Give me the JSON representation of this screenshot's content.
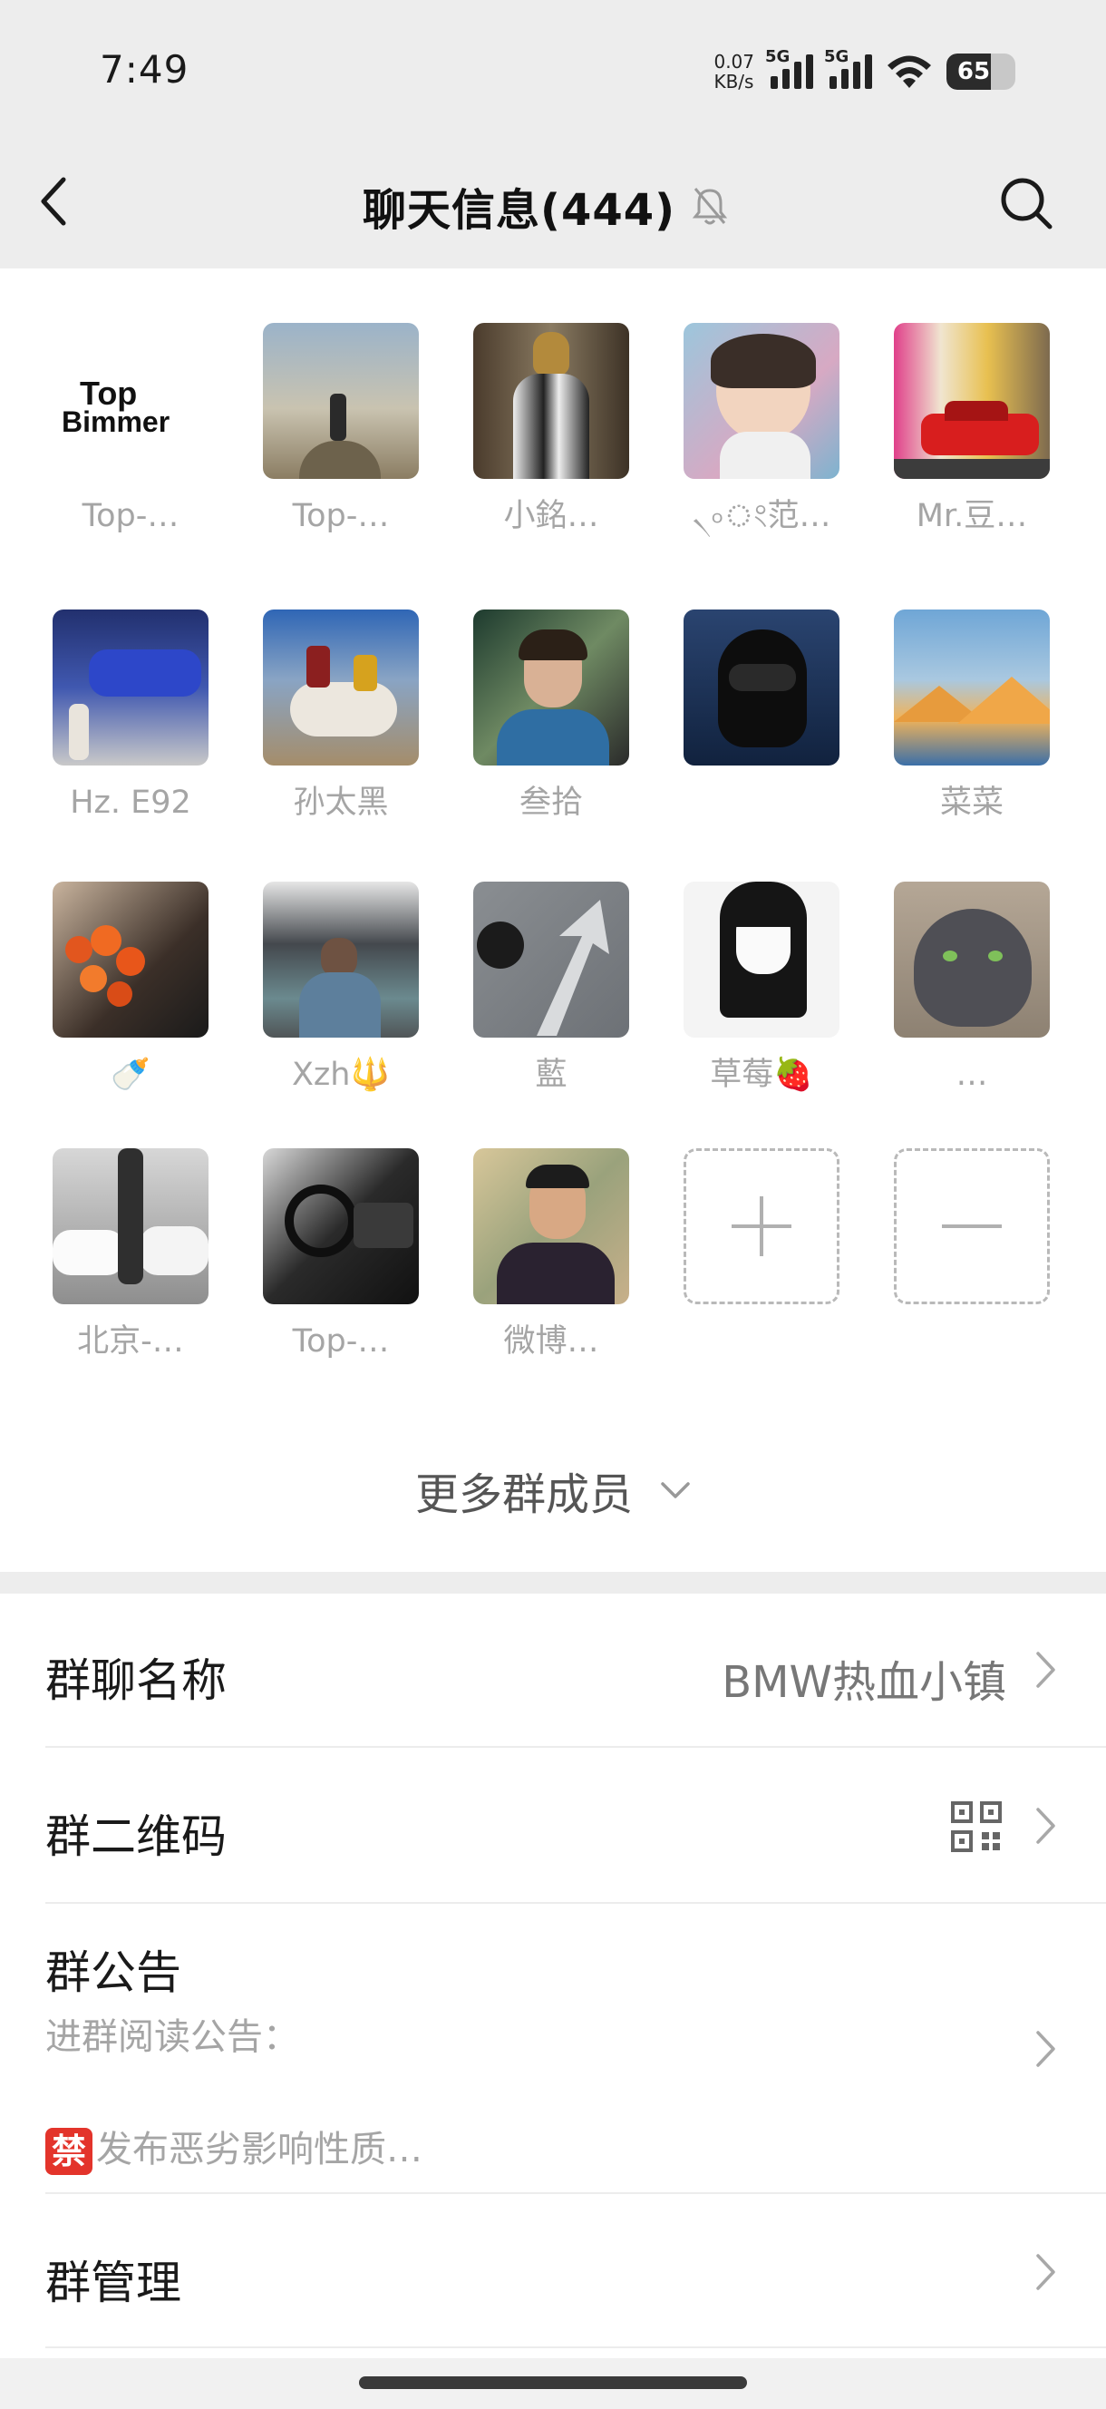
{
  "status_bar": {
    "time": "7:49",
    "net_speed_value": "0.07",
    "net_speed_unit": "KB/s",
    "signal1_label": "5G",
    "signal2_label": "5G",
    "battery_level": 65,
    "battery_text": "65"
  },
  "header": {
    "title": "聊天信息(444)",
    "muted": true
  },
  "members": [
    {
      "name": "Top-…",
      "avatar": "logo-top-bimmer"
    },
    {
      "name": "Top-…",
      "avatar": "photo-desert-person"
    },
    {
      "name": "小銘…",
      "avatar": "photo-iron-man"
    },
    {
      "name": "৲৹ং范…",
      "avatar": "photo-child"
    },
    {
      "name": "Mr.豆…",
      "avatar": "photo-red-car"
    },
    {
      "name": "Hz. E92",
      "avatar": "photo-blue-bmw"
    },
    {
      "name": "孙太黑",
      "avatar": "photo-yak-riders"
    },
    {
      "name": "叁拾",
      "avatar": "photo-young-man"
    },
    {
      "name": "",
      "avatar": "photo-black-helmet"
    },
    {
      "name": "菜菜",
      "avatar": "photo-mountains"
    },
    {
      "name": "🍼",
      "avatar": "photo-orange-flowers"
    },
    {
      "name": "Xzh🔱",
      "avatar": "photo-lake-man"
    },
    {
      "name": "藍",
      "avatar": "photo-arrow-road"
    },
    {
      "name": "草莓🍓",
      "avatar": "drawing-anime-girl"
    },
    {
      "name": "…",
      "avatar": "photo-gray-cat"
    },
    {
      "name": "北京-…",
      "avatar": "photo-white-cars"
    },
    {
      "name": "Top-…",
      "avatar": "photo-car-interior"
    },
    {
      "name": "微博…",
      "avatar": "photo-man-portrait"
    }
  ],
  "more_members_label": "更多群成员",
  "settings": {
    "group_name_label": "群聊名称",
    "group_name_value": "BMW热血小镇",
    "qr_label": "群二维码",
    "notice_label": "群公告",
    "notice_intro": "进群阅读公告：",
    "notice_badge": "禁",
    "notice_preview": "发布恶劣影响性质…",
    "manage_label": "群管理"
  },
  "logo_text": {
    "line1": "Top",
    "line2": "Bimmer"
  },
  "colors": {
    "header_bg": "#ededed",
    "muted_text": "#a5a5a5",
    "ban_red": "#e3342b"
  }
}
